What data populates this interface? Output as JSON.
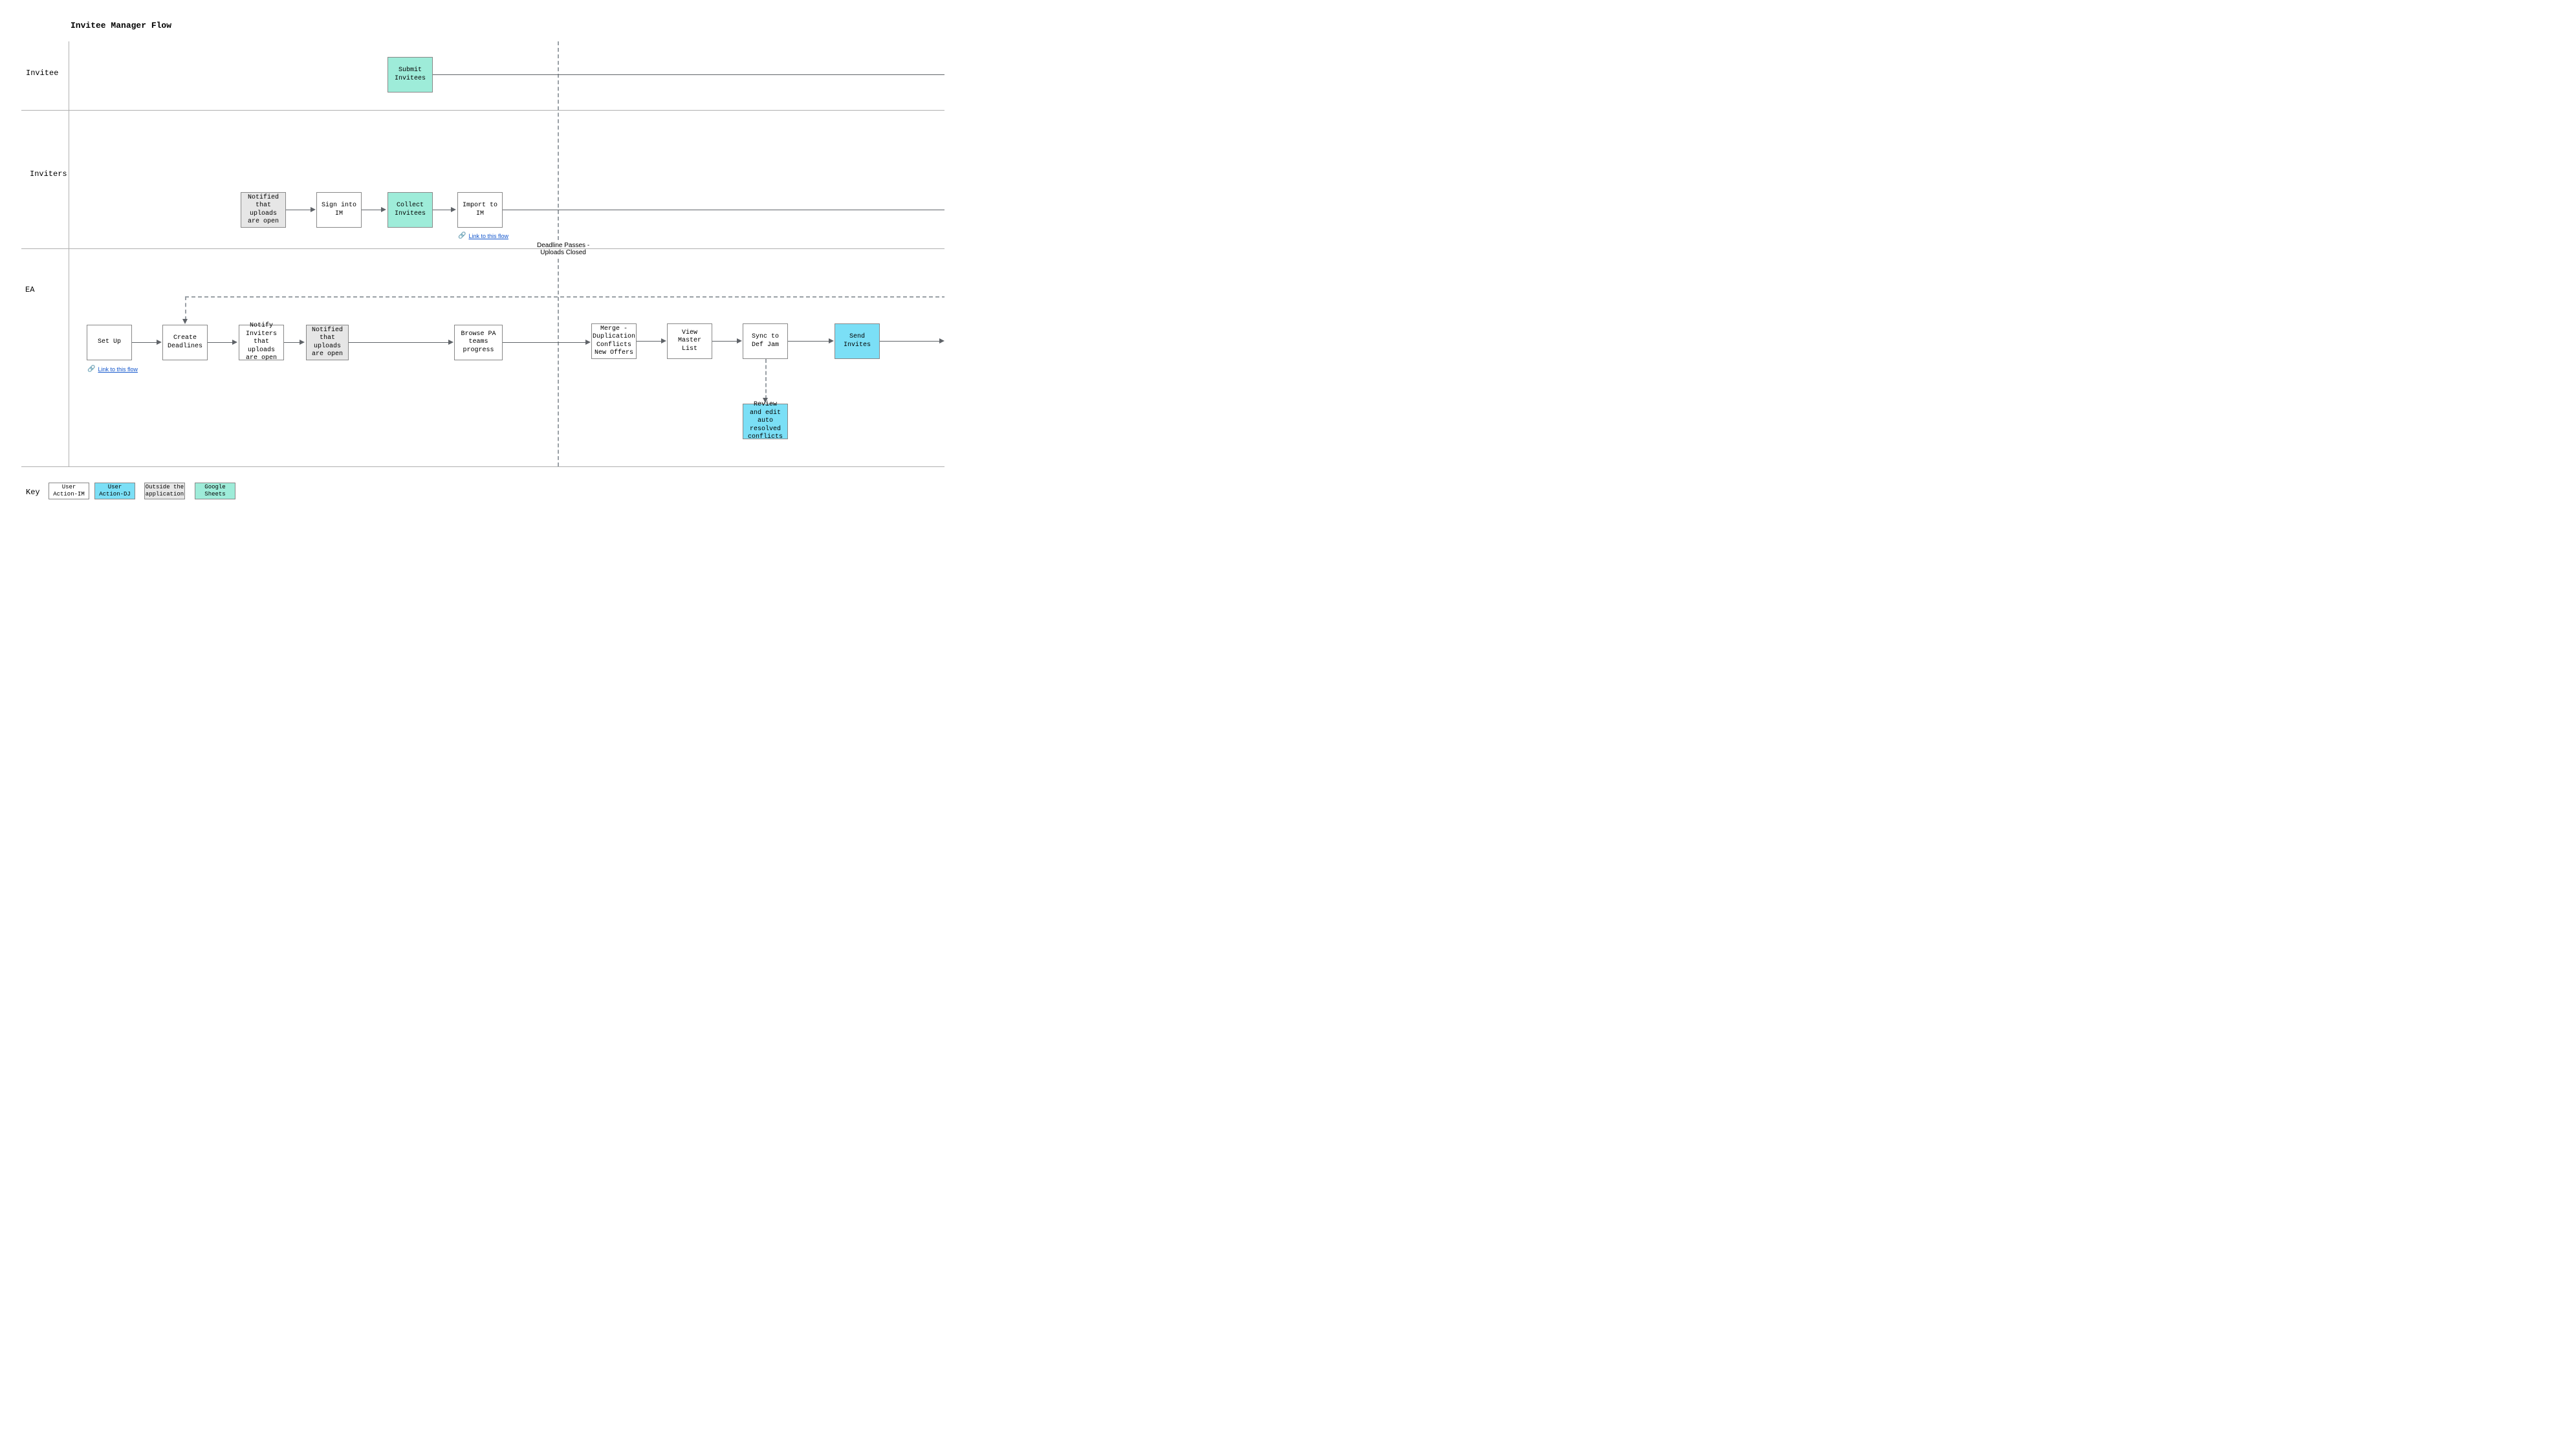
{
  "title": "Invitee Manager Flow",
  "lanes": {
    "invitee": "Invitee",
    "inviters": "Inviters",
    "ea": "EA"
  },
  "deadline_label": "Deadline Passes -\nUploads Closed",
  "link_text": "Link to this flow",
  "nodes": {
    "submit_invitees": "Submit Invitees",
    "notified_uploads_open_inv": "Notified that uploads are open",
    "sign_into_im": "Sign into IM",
    "collect_invitees": "Collect Invitees",
    "import_to_im": "Import to IM",
    "set_up": "Set Up",
    "create_deadlines": "Create Deadlines",
    "notify_inviters": "Notify Inviters that uploads are open",
    "notified_uploads_open_ea": "Notified that uploads are open",
    "browse_pa": "Browse PA teams progress",
    "merge": "Merge - Duplication Conflicts New Offers",
    "view_master": "View Master List",
    "sync_defjam": "Sync to Def Jam",
    "send_invites": "Send Invites",
    "review_conflicts": "Review and edit auto resolved conflicts"
  },
  "key": {
    "label": "Key",
    "im": "User Action-IM",
    "dj": "User Action-DJ",
    "outside": "Outside the application",
    "sheets": "Google Sheets"
  }
}
